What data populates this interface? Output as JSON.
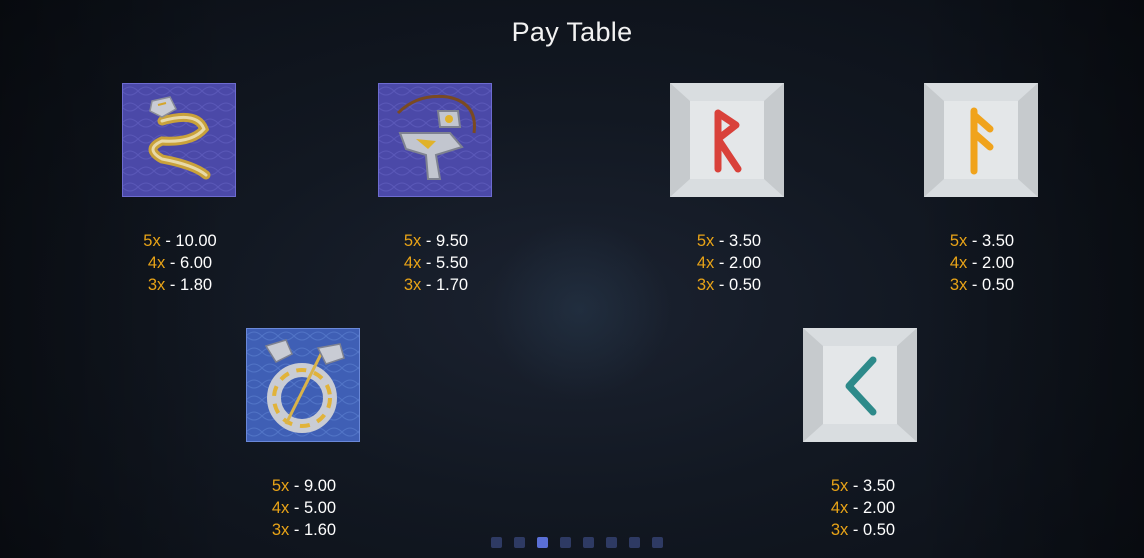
{
  "title": "Pay Table",
  "symbols": [
    {
      "icon": "dragon-armband-icon",
      "pays": [
        {
          "mult": "5x",
          "sep": " - ",
          "value": "10.00"
        },
        {
          "mult": "4x",
          "sep": " - ",
          "value": "6.00"
        },
        {
          "mult": "3x",
          "sep": " - ",
          "value": "1.80"
        }
      ]
    },
    {
      "icon": "hammer-amulet-icon",
      "pays": [
        {
          "mult": "5x",
          "sep": " - ",
          "value": "9.50"
        },
        {
          "mult": "4x",
          "sep": " - ",
          "value": "5.50"
        },
        {
          "mult": "3x",
          "sep": " - ",
          "value": "1.70"
        }
      ]
    },
    {
      "icon": "raido-rune-icon",
      "pays": [
        {
          "mult": "5x",
          "sep": " - ",
          "value": "3.50"
        },
        {
          "mult": "4x",
          "sep": " - ",
          "value": "2.00"
        },
        {
          "mult": "3x",
          "sep": " - ",
          "value": "0.50"
        }
      ]
    },
    {
      "icon": "ansuz-rune-icon",
      "pays": [
        {
          "mult": "5x",
          "sep": " - ",
          "value": "3.50"
        },
        {
          "mult": "4x",
          "sep": " - ",
          "value": "2.00"
        },
        {
          "mult": "3x",
          "sep": " - ",
          "value": "0.50"
        }
      ]
    },
    {
      "icon": "dragon-ring-icon",
      "pays": [
        {
          "mult": "5x",
          "sep": " - ",
          "value": "9.00"
        },
        {
          "mult": "4x",
          "sep": " - ",
          "value": "5.00"
        },
        {
          "mult": "3x",
          "sep": " - ",
          "value": "1.60"
        }
      ]
    },
    {
      "icon": "kaunan-rune-icon",
      "pays": [
        {
          "mult": "5x",
          "sep": " - ",
          "value": "3.50"
        },
        {
          "mult": "4x",
          "sep": " - ",
          "value": "2.00"
        },
        {
          "mult": "3x",
          "sep": " - ",
          "value": "0.50"
        }
      ]
    }
  ],
  "pagination": {
    "count": 8,
    "active_index": 2
  },
  "colors": {
    "multiplier": "#e8a317",
    "value": "#ffffff",
    "jewel_bg_purple": "#4b49a8",
    "jewel_bg_blue": "#3f5fb5",
    "rune_stone": "#d9dde0",
    "rune_red": "#d9413a",
    "rune_orange": "#f0a31c",
    "rune_teal": "#2d8a8a",
    "dot_active": "#5a6fd6",
    "dot_inactive": "#2e3a63"
  }
}
